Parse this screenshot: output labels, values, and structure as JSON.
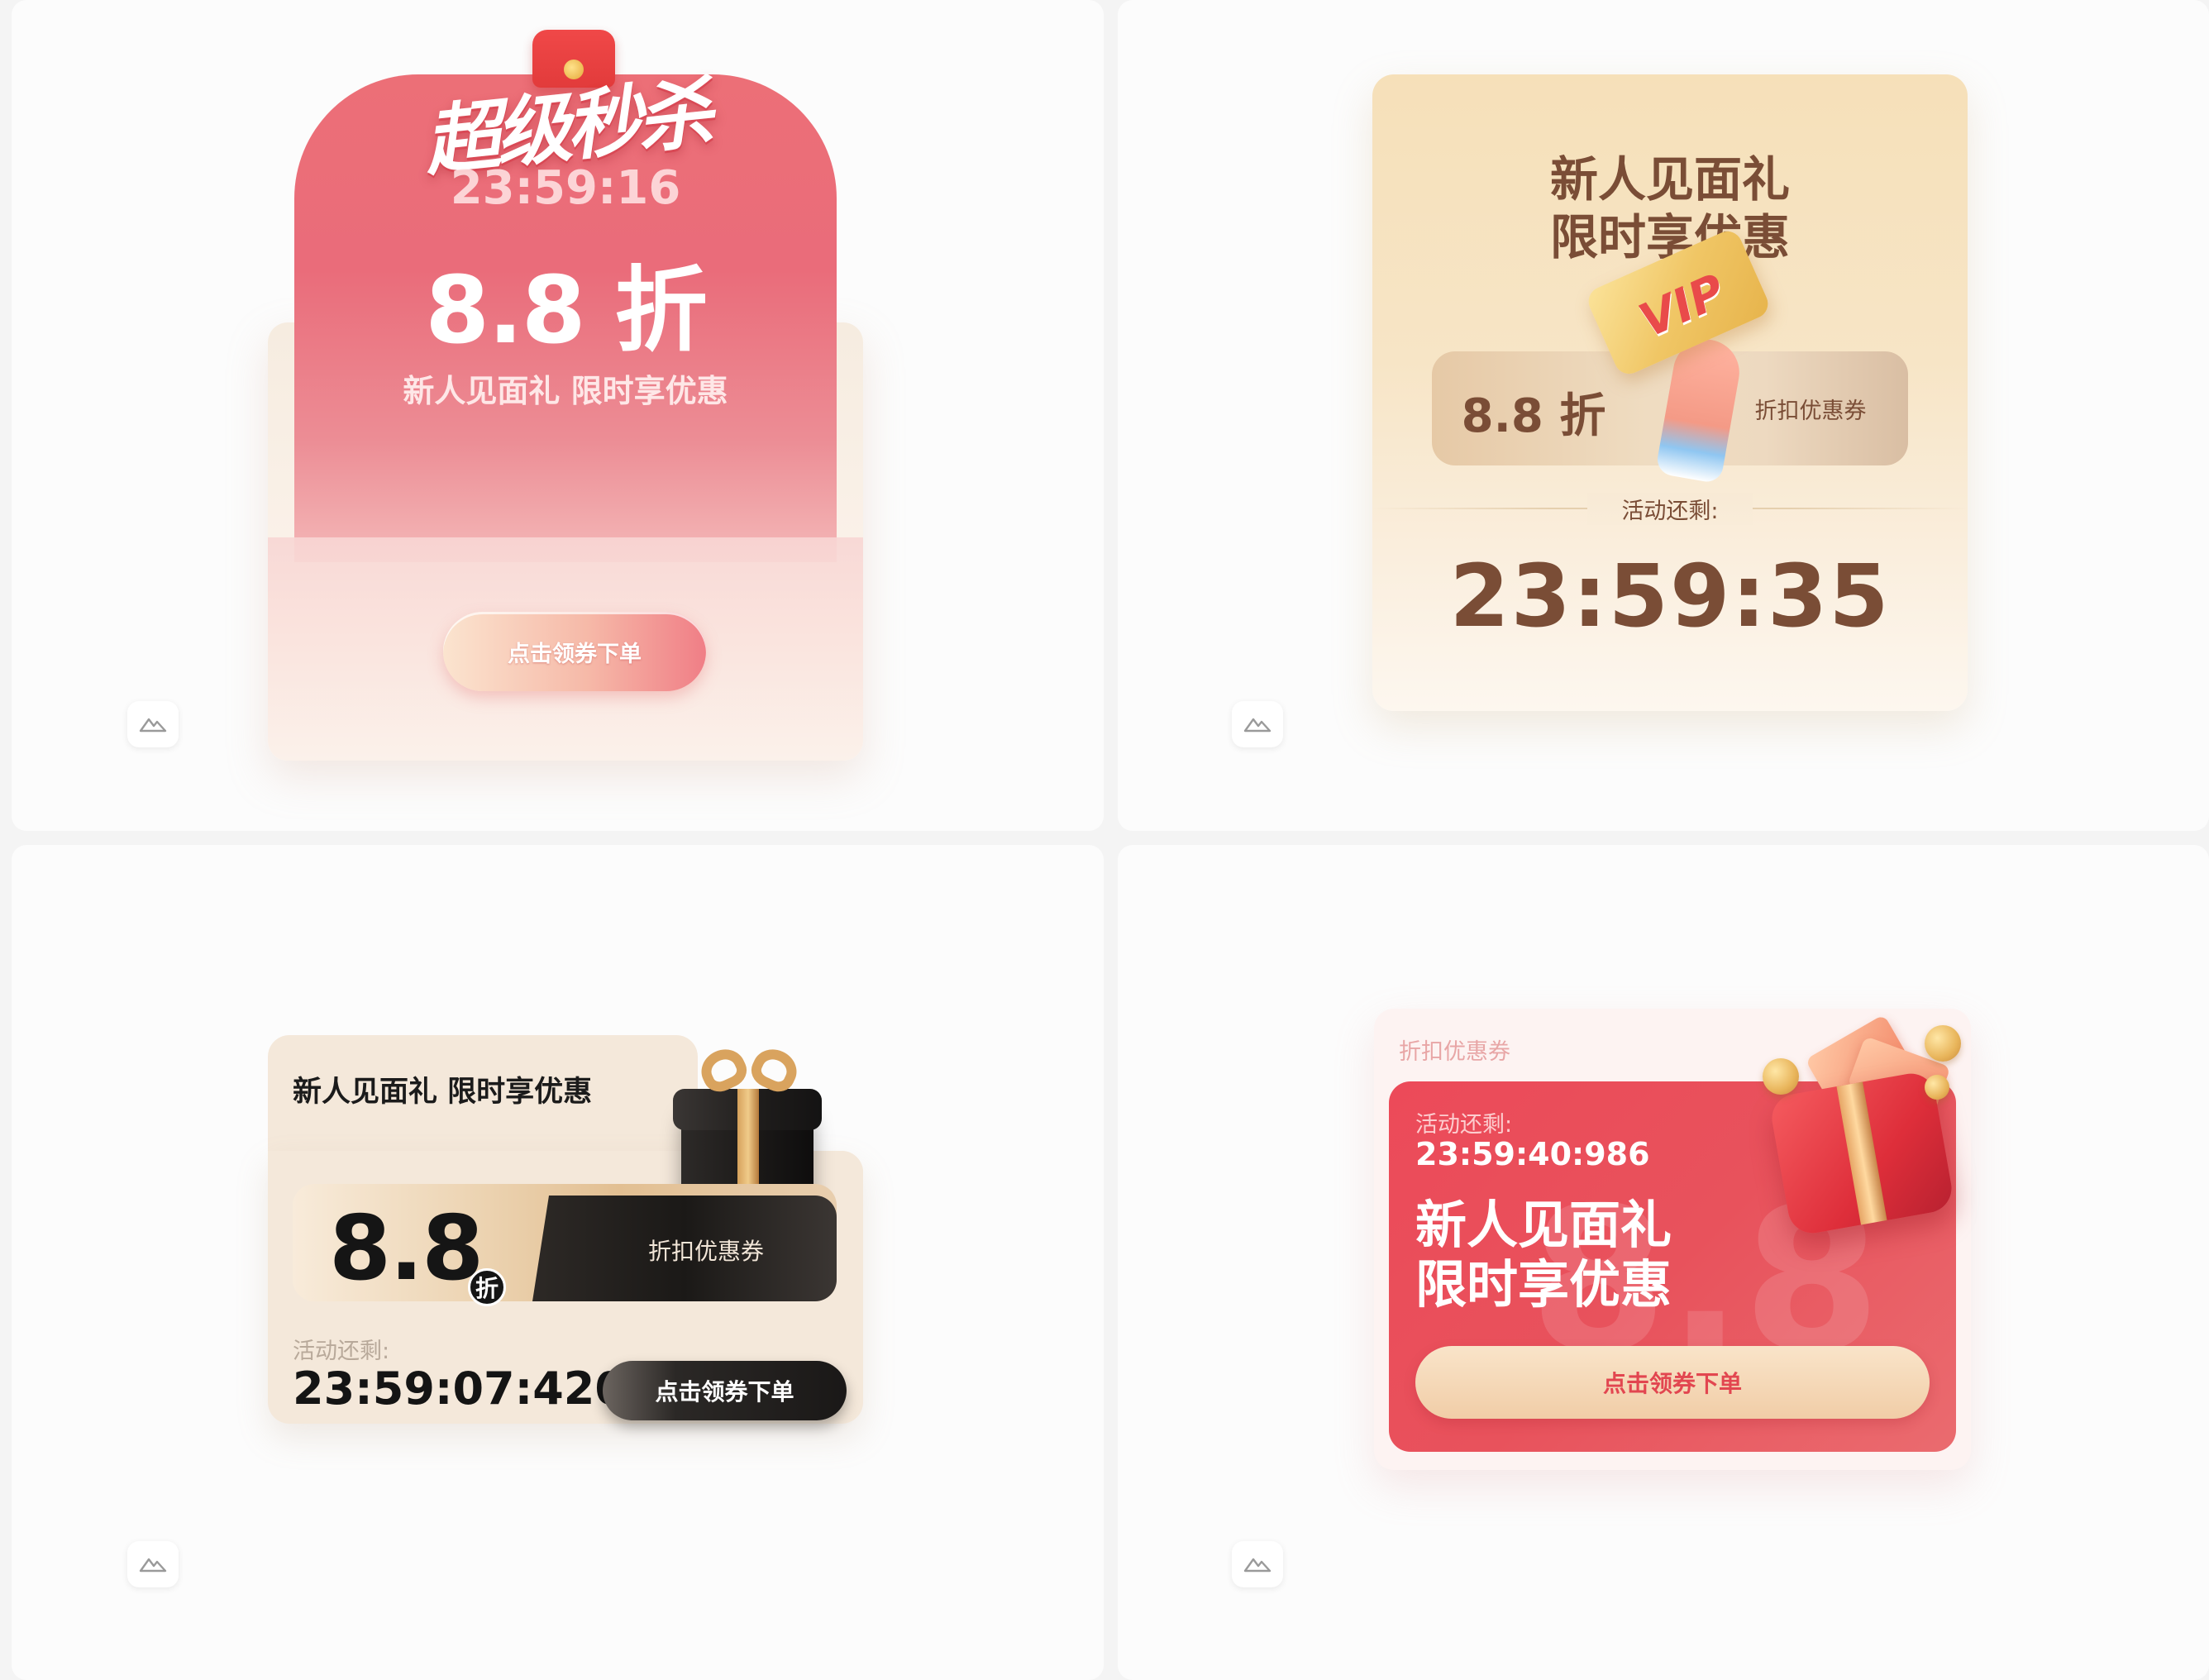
{
  "card1": {
    "title": "超级秒杀",
    "timer": "23:59:16",
    "discount": "8.8 折",
    "subtitle": "新人见面礼 限时享优惠",
    "button": "点击领券下单"
  },
  "card2": {
    "title_line1": "新人见面礼",
    "title_line2": "限时享优惠",
    "badge": "VIP",
    "discount": "8.8 折",
    "coupon_label": "折扣优惠券",
    "remain_label": "活动还剩:",
    "timer": "23:59:35"
  },
  "card3": {
    "title": "新人见面礼 限时享优惠",
    "discount": "8.8",
    "discount_unit": "折",
    "coupon_label": "折扣优惠券",
    "remain_label": "活动还剩:",
    "timer": "23:59:07:420",
    "button": "点击领券下单"
  },
  "card4": {
    "top_label": "折扣优惠券",
    "remain_label": "活动还剩:",
    "timer": "23:59:40:986",
    "title_line1": "新人见面礼",
    "title_line2": "限时享优惠",
    "bg_number": "8.8",
    "button": "点击领券下单"
  },
  "icons": {
    "watermark": "mountain-logo-icon",
    "gift_black": "gift-box-icon",
    "gift_red": "gift-box-icon",
    "vip_card": "vip-card-icon"
  },
  "colors": {
    "red_primary": "#ea6c7a",
    "brown_text": "#7a4d36",
    "dark_text": "#151515",
    "coral_button_text": "#e24650"
  }
}
